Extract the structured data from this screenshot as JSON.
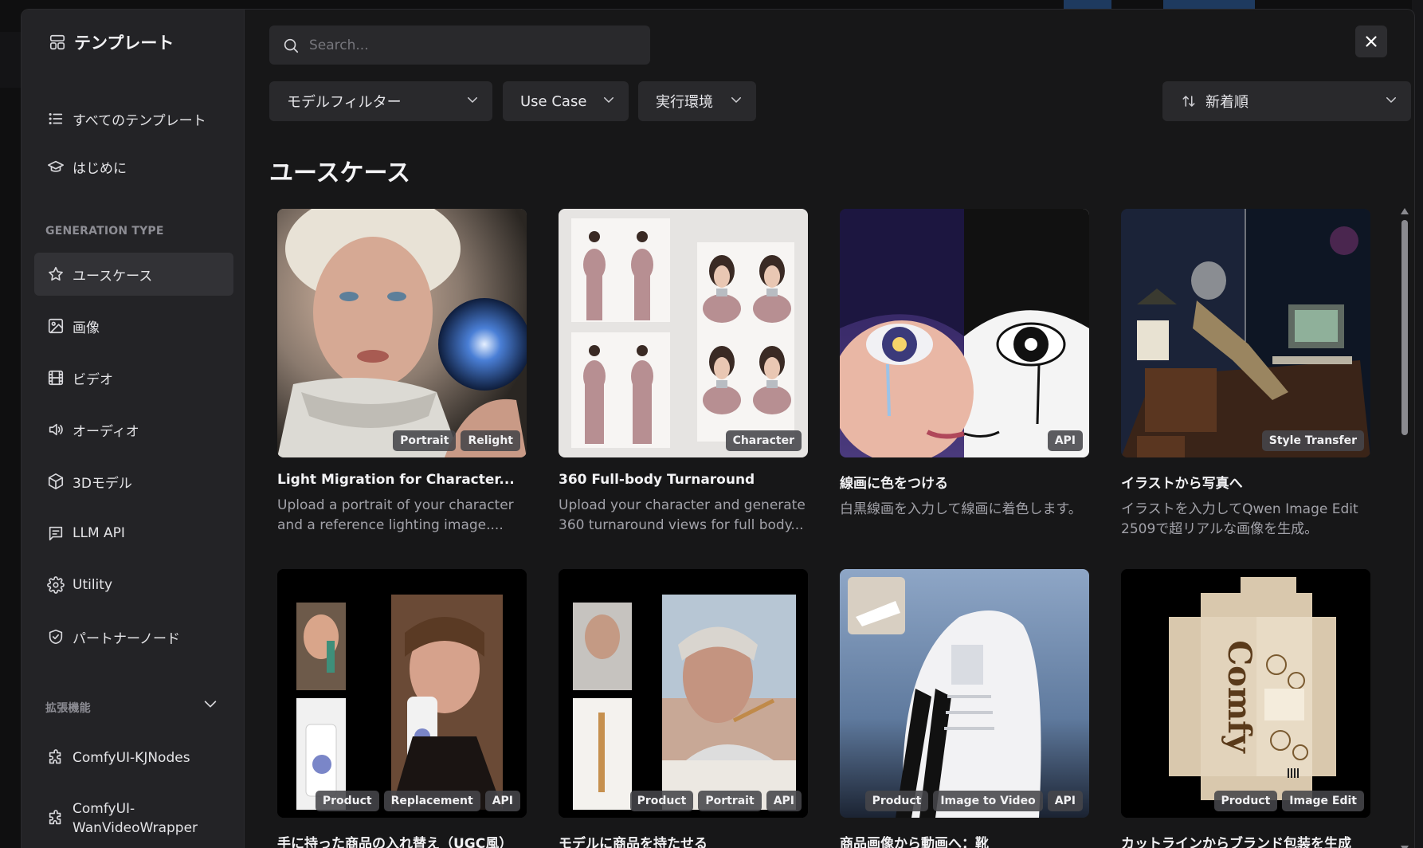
{
  "sidebar": {
    "title": "テンプレート",
    "nav": [
      {
        "label": "すべてのテンプレート",
        "icon": "list-icon"
      },
      {
        "label": "はじめに",
        "icon": "graduation-cap-icon"
      }
    ],
    "generation_type_label": "GENERATION TYPE",
    "types": [
      {
        "label": "ユースケース",
        "icon": "star-icon",
        "active": true
      },
      {
        "label": "画像",
        "icon": "image-icon"
      },
      {
        "label": "ビデオ",
        "icon": "film-icon"
      },
      {
        "label": "オーディオ",
        "icon": "speaker-icon"
      },
      {
        "label": "3Dモデル",
        "icon": "cube-icon"
      },
      {
        "label": "LLM API",
        "icon": "chat-icon"
      },
      {
        "label": "Utility",
        "icon": "gear-icon"
      },
      {
        "label": "パートナーノード",
        "icon": "shield-icon"
      }
    ],
    "extensions_label": "拡張機能",
    "extensions": [
      {
        "label": "ComfyUI-KJNodes",
        "icon": "puzzle-icon"
      },
      {
        "label": "ComfyUI-\nWanVideoWrapper",
        "icon": "puzzle-icon"
      }
    ]
  },
  "search": {
    "placeholder": "Search..."
  },
  "filters": {
    "model": "モデルフィルター",
    "use_case": "Use Case",
    "runtime": "実行環境",
    "sort": "新着順"
  },
  "heading": "ユースケース",
  "cards": [
    {
      "title": "Light Migration for Character...",
      "desc": "Upload a portrait of your character and a reference lighting image....",
      "tags": [
        "Portrait",
        "Relight"
      ],
      "art": "relight"
    },
    {
      "title": "360 Full-body Turnaround",
      "desc": "Upload your character and generate 360 turnaround views for full body...",
      "tags": [
        "Character"
      ],
      "art": "turnaround"
    },
    {
      "title": "線画に色をつける",
      "desc": "白黒線画を入力して線画に着色します。",
      "tags": [
        "API"
      ],
      "art": "lineart"
    },
    {
      "title": "イラストから写真へ",
      "desc": "イラストを入力してQwen Image Edit 2509で超リアルな画像を生成。",
      "tags": [
        "Style Transfer"
      ],
      "art": "illustration"
    },
    {
      "title": "手に持った商品の入れ替え（UGC風）",
      "desc": "",
      "tags": [
        "Product",
        "Replacement",
        "API"
      ],
      "art": "ugc"
    },
    {
      "title": "モデルに商品を持たせる",
      "desc": "",
      "tags": [
        "Product",
        "Portrait",
        "API"
      ],
      "art": "model"
    },
    {
      "title": "商品画像から動画へ：靴",
      "desc": "",
      "tags": [
        "Product",
        "Image to Video",
        "API"
      ],
      "art": "shoe"
    },
    {
      "title": "カットラインからブランド包装を生成",
      "desc": "",
      "tags": [
        "Product",
        "Image Edit"
      ],
      "art": "packaging"
    }
  ],
  "packaging_brand": "Comfy",
  "colors": {
    "accent_active": "#323236",
    "modal_bg": "#171718",
    "sidebar_bg": "#232326"
  }
}
